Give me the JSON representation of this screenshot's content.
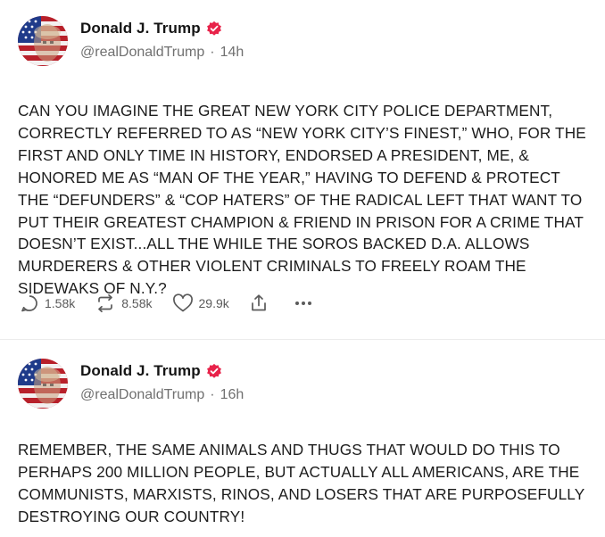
{
  "posts": [
    {
      "author": "Donald J. Trump",
      "handle": "@realDonaldTrump",
      "time": "14h",
      "text": "CAN YOU IMAGINE THE GREAT NEW YORK CITY POLICE DEPARTMENT, CORRECTLY REFERRED TO AS “NEW YORK CITY’S FINEST,” WHO, FOR THE FIRST AND ONLY TIME IN HISTORY, ENDORSED A PRESIDENT, ME, & HONORED ME AS “MAN OF THE YEAR,” HAVING TO DEFEND & PROTECT THE “DEFUNDERS” & “COP HATERS” OF THE RADICAL LEFT THAT WANT TO PUT THEIR GREATEST CHAMPION & FRIEND IN PRISON FOR A CRIME THAT DOESN’T EXIST...ALL THE WHILE THE SOROS BACKED D.A. ALLOWS MURDERERS & OTHER VIOLENT CRIMINALS TO FREELY ROAM THE SIDEWAKS OF N.Y.?",
      "replies": "1.58k",
      "retruths": "8.58k",
      "likes": "29.9k"
    },
    {
      "author": "Donald J. Trump",
      "handle": "@realDonaldTrump",
      "time": "16h",
      "text": "REMEMBER, THE SAME ANIMALS AND THUGS THAT WOULD DO THIS TO PERHAPS 200 MILLION PEOPLE, BUT ACTUALLY ALL AMERICANS, ARE THE COMMUNISTS, MARXISTS, RINOS, AND LOSERS THAT ARE PURPOSEFULLY DESTROYING OUR COUNTRY!"
    }
  ],
  "separator": "·",
  "more_label": "•••",
  "icons": {
    "verified": "verified-badge-icon",
    "reply": "reply-icon",
    "retruth": "retruth-icon",
    "like": "heart-icon",
    "share": "share-icon",
    "more": "more-icon"
  },
  "colors": {
    "verified": "#e8234a",
    "secondary_text": "#707070",
    "action_text": "#5a5a5a"
  }
}
